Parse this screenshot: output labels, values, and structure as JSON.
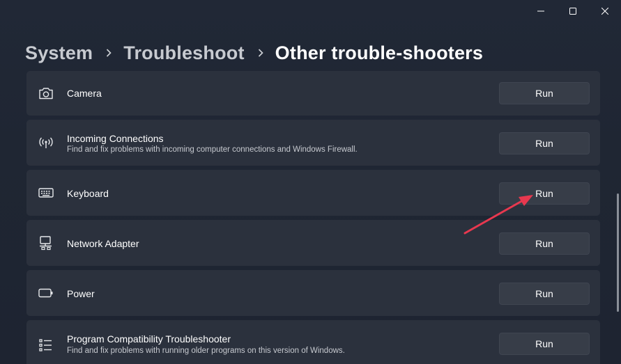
{
  "window_controls": {
    "minimize": "minimize-icon",
    "maximize": "maximize-icon",
    "close": "close-icon"
  },
  "breadcrumb": {
    "items": [
      "System",
      "Troubleshoot",
      "Other trouble-shooters"
    ]
  },
  "troubleshooters": [
    {
      "title": "Camera",
      "description": "",
      "icon": "camera-icon",
      "button": "Run"
    },
    {
      "title": "Incoming Connections",
      "description": "Find and fix problems with incoming computer connections and Windows Firewall.",
      "icon": "antenna-icon",
      "button": "Run"
    },
    {
      "title": "Keyboard",
      "description": "",
      "icon": "keyboard-icon",
      "button": "Run"
    },
    {
      "title": "Network Adapter",
      "description": "",
      "icon": "network-adapter-icon",
      "button": "Run"
    },
    {
      "title": "Power",
      "description": "",
      "icon": "battery-icon",
      "button": "Run"
    },
    {
      "title": "Program Compatibility Troubleshooter",
      "description": "Find and fix problems with running older programs on this version of Windows.",
      "icon": "program-list-icon",
      "button": "Run"
    }
  ],
  "annotation": {
    "color": "#e8384f",
    "icon": "pointer-arrow"
  },
  "colors": {
    "background": "#1f2632",
    "card": "#2b313d",
    "button": "#373d48"
  }
}
